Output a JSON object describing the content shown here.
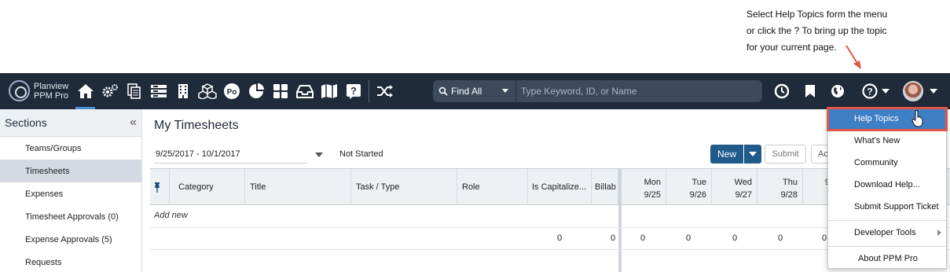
{
  "callout": {
    "lines": [
      "Select Help Topics form the menu",
      "or click the ? To bring up the topic",
      "for your current page."
    ]
  },
  "brand": {
    "line1": "Planview",
    "line2": "PPM Pro"
  },
  "nav_icons": [
    "home-icon",
    "gears-icon",
    "documents-icon",
    "list-icon",
    "building-icon",
    "boxes-icon",
    "po-icon",
    "pie-chart-icon",
    "grid-icon",
    "inbox-icon",
    "map-icon",
    "question-box-icon",
    "shuffle-icon"
  ],
  "nav_po_label": "Po",
  "search": {
    "scope": "Find All",
    "placeholder": "Type Keyword, ID, or Name"
  },
  "sidebar": {
    "title": "Sections",
    "collapse_glyph": "«",
    "items": [
      {
        "label": "Teams/Groups",
        "selected": false
      },
      {
        "label": "Timesheets",
        "selected": true
      },
      {
        "label": "Expenses",
        "selected": false
      },
      {
        "label": "Timesheet Approvals (0)",
        "selected": false
      },
      {
        "label": "Expense Approvals (5)",
        "selected": false
      },
      {
        "label": "Requests",
        "selected": false
      }
    ]
  },
  "main": {
    "title": "My Timesheets",
    "date_range": "9/25/2017 - 10/1/2017",
    "status": "Not Started",
    "new_label": "New",
    "submit_label": "Submit",
    "more_label": "Ac"
  },
  "grid": {
    "columns": [
      "Category",
      "Title",
      "Task / Type",
      "Role",
      "Is Capitalize...",
      "Billab"
    ],
    "days": [
      {
        "day": "Mon",
        "date": "9/25"
      },
      {
        "day": "Tue",
        "date": "9/26"
      },
      {
        "day": "Wed",
        "date": "9/27"
      },
      {
        "day": "Thu",
        "date": "9/28"
      },
      {
        "day": "",
        "date": "9"
      }
    ],
    "add_new": "Add new",
    "totals": [
      "0",
      "0",
      "0",
      "0",
      "0",
      "0",
      "0"
    ]
  },
  "help_menu": {
    "items": [
      "Help Topics",
      "What's New",
      "Community",
      "Download Help...",
      "Submit Support Ticket",
      "Developer Tools",
      "About PPM Pro"
    ],
    "highlighted": "Help Topics"
  },
  "colors": {
    "topbar": "#1f2a3a",
    "accent": "#3f7fc6",
    "highlight_border": "#e05545",
    "arrow": "#e05545"
  }
}
